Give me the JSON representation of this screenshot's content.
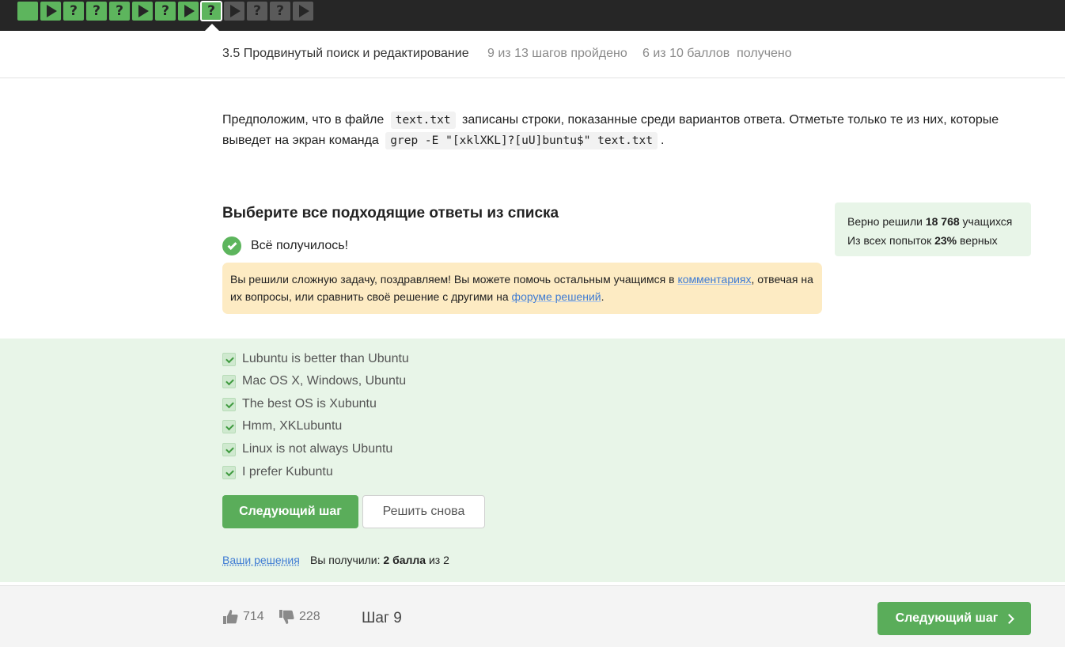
{
  "steps": [
    {
      "type": "done-text",
      "label": ""
    },
    {
      "type": "play",
      "label": ""
    },
    {
      "type": "quiz",
      "label": "?"
    },
    {
      "type": "quiz",
      "label": "?"
    },
    {
      "type": "quiz",
      "label": "?"
    },
    {
      "type": "play",
      "label": ""
    },
    {
      "type": "quiz",
      "label": "?"
    },
    {
      "type": "play",
      "label": ""
    },
    {
      "type": "quiz-current",
      "label": "?"
    },
    {
      "type": "play-todo",
      "label": ""
    },
    {
      "type": "quiz-todo",
      "label": "?"
    },
    {
      "type": "quiz-todo",
      "label": "?"
    },
    {
      "type": "play-todo",
      "label": ""
    }
  ],
  "header": {
    "lesson_title": "3.5 Продвинутый поиск и редактирование",
    "progress": "9 из 13 шагов пройдено",
    "score": "6 из 10 баллов  получено"
  },
  "question": {
    "part1": "Предположим, что в файле",
    "code1": "text.txt",
    "part2": "записаны строки, показанные среди вариантов ответа. Отметьте только те из них, которые выведет на экран команда",
    "code2": "grep -E \"[xklXKL]?[uU]buntu$\" text.txt",
    "part3": "."
  },
  "choose_title": "Выберите все подходящие ответы из списка",
  "success": "Всё получилось!",
  "note": {
    "text1": "Вы решили сложную задачу, поздравляем! Вы можете помочь остальным учащимся в",
    "link1": "комментариях",
    "text2": ", отвечая на их вопросы, или сравнить своё решение с другими на",
    "link2": "форуме решений",
    "text3": "."
  },
  "stats": {
    "line1_prefix": "Верно решили",
    "solved_count": "18 768",
    "line1_suffix": "учащихся",
    "line2_prefix": "Из всех попыток",
    "percent": "23%",
    "line2_suffix": "верных"
  },
  "options": [
    "Lubuntu is better than Ubuntu",
    "Mac OS X, Windows, Ubuntu",
    "The best OS is Xubuntu",
    "Hmm, XKLubuntu",
    "Linux is not always Ubuntu",
    "I prefer Kubuntu"
  ],
  "buttons": {
    "next": "Следующий шаг",
    "again": "Решить снова",
    "next_footer": "Следующий шаг"
  },
  "result": {
    "your_solutions": "Ваши решения",
    "got_prefix": "Вы получили:",
    "got_points": "2 балла",
    "got_suffix": "из 2"
  },
  "footer": {
    "likes": "714",
    "dislikes": "228",
    "step_label": "Шаг 9"
  },
  "colors": {
    "accent_green": "#5aad5a",
    "success_bg": "#e8f5e8",
    "note_bg": "#fdebc3",
    "link": "#3e7bd3"
  }
}
